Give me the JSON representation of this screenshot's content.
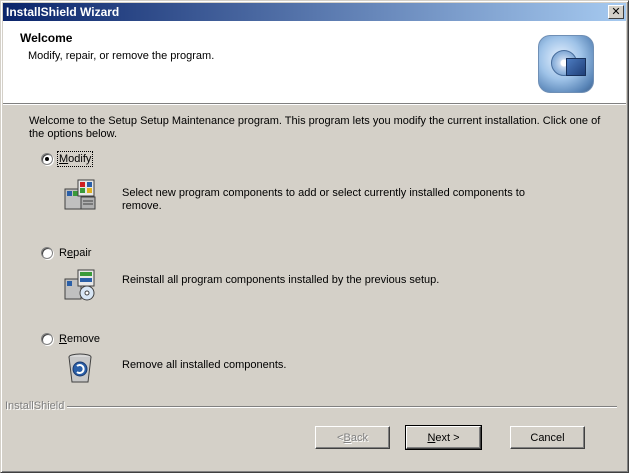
{
  "window": {
    "title": "InstallShield Wizard",
    "close_glyph": "✕"
  },
  "header": {
    "title": "Welcome",
    "subtitle": "Modify, repair, or remove the program.",
    "logo_icon": "installshield-setup-icon"
  },
  "intro_text": "Welcome to the Setup Setup Maintenance program. This program lets you modify the current installation. Click one of the options below.",
  "options": [
    {
      "label_prefix": "",
      "label_key": "M",
      "label_rest": "odify",
      "selected": true,
      "icon": "modify-components-icon",
      "description": "Select new program components to add or select currently installed components to remove."
    },
    {
      "label_prefix": "R",
      "label_key": "e",
      "label_rest": "pair",
      "selected": false,
      "icon": "repair-components-icon",
      "description": "Reinstall all program components installed by the previous setup."
    },
    {
      "label_prefix": "",
      "label_key": "R",
      "label_rest": "emove",
      "selected": false,
      "icon": "remove-recycle-bin-icon",
      "description": "Remove all installed components."
    }
  ],
  "branding": "InstallShield",
  "buttons": {
    "back": {
      "prefix": "< ",
      "key": "B",
      "rest": "ack",
      "enabled": false
    },
    "next": {
      "prefix": "",
      "key": "N",
      "rest": "ext >",
      "enabled": true
    },
    "cancel": {
      "label": "Cancel"
    }
  }
}
